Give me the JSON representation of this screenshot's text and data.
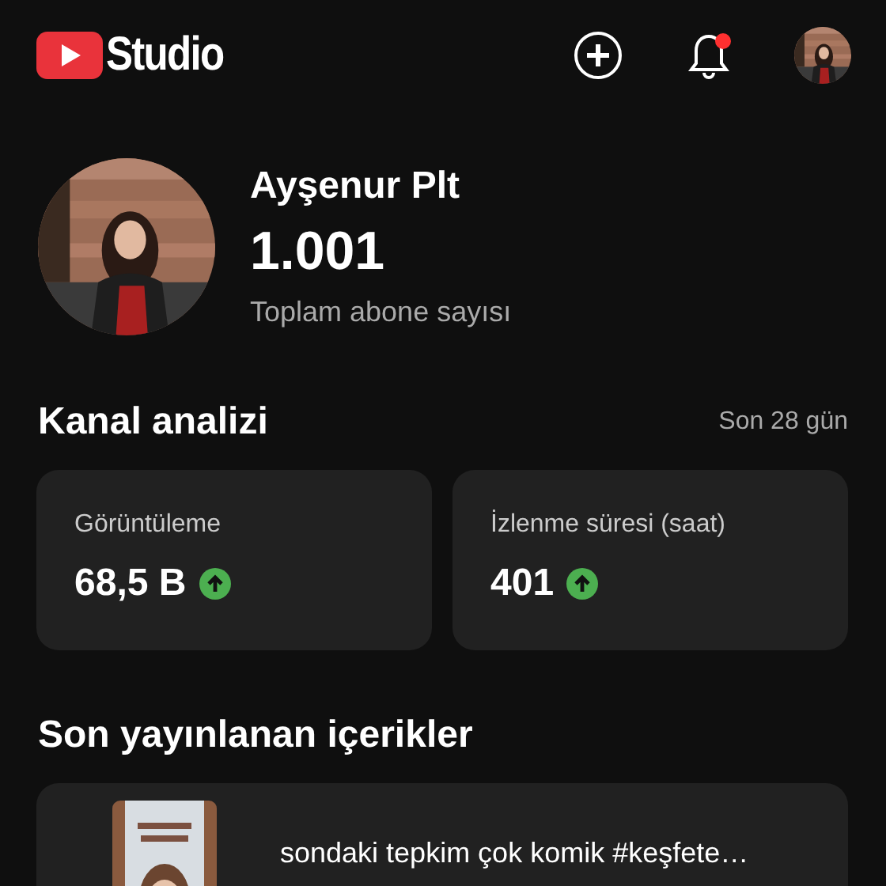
{
  "header": {
    "logo_text": "Studio",
    "notification_badge": true
  },
  "channel": {
    "name": "Ayşenur Plt",
    "subscribers": "1.001",
    "subscribers_label": "Toplam abone sayısı"
  },
  "analytics": {
    "title": "Kanal analizi",
    "period": "Son 28 gün",
    "metrics": [
      {
        "label": "Görüntüleme",
        "value": "68,5 B",
        "rising": true
      },
      {
        "label": "İzlenme süresi (saat)",
        "value": "401",
        "rising": true
      }
    ]
  },
  "recent": {
    "title": "Son yayınlanan içerikler",
    "items": [
      {
        "title": "sondaki tepkim çok komik #keşfete…"
      }
    ]
  }
}
